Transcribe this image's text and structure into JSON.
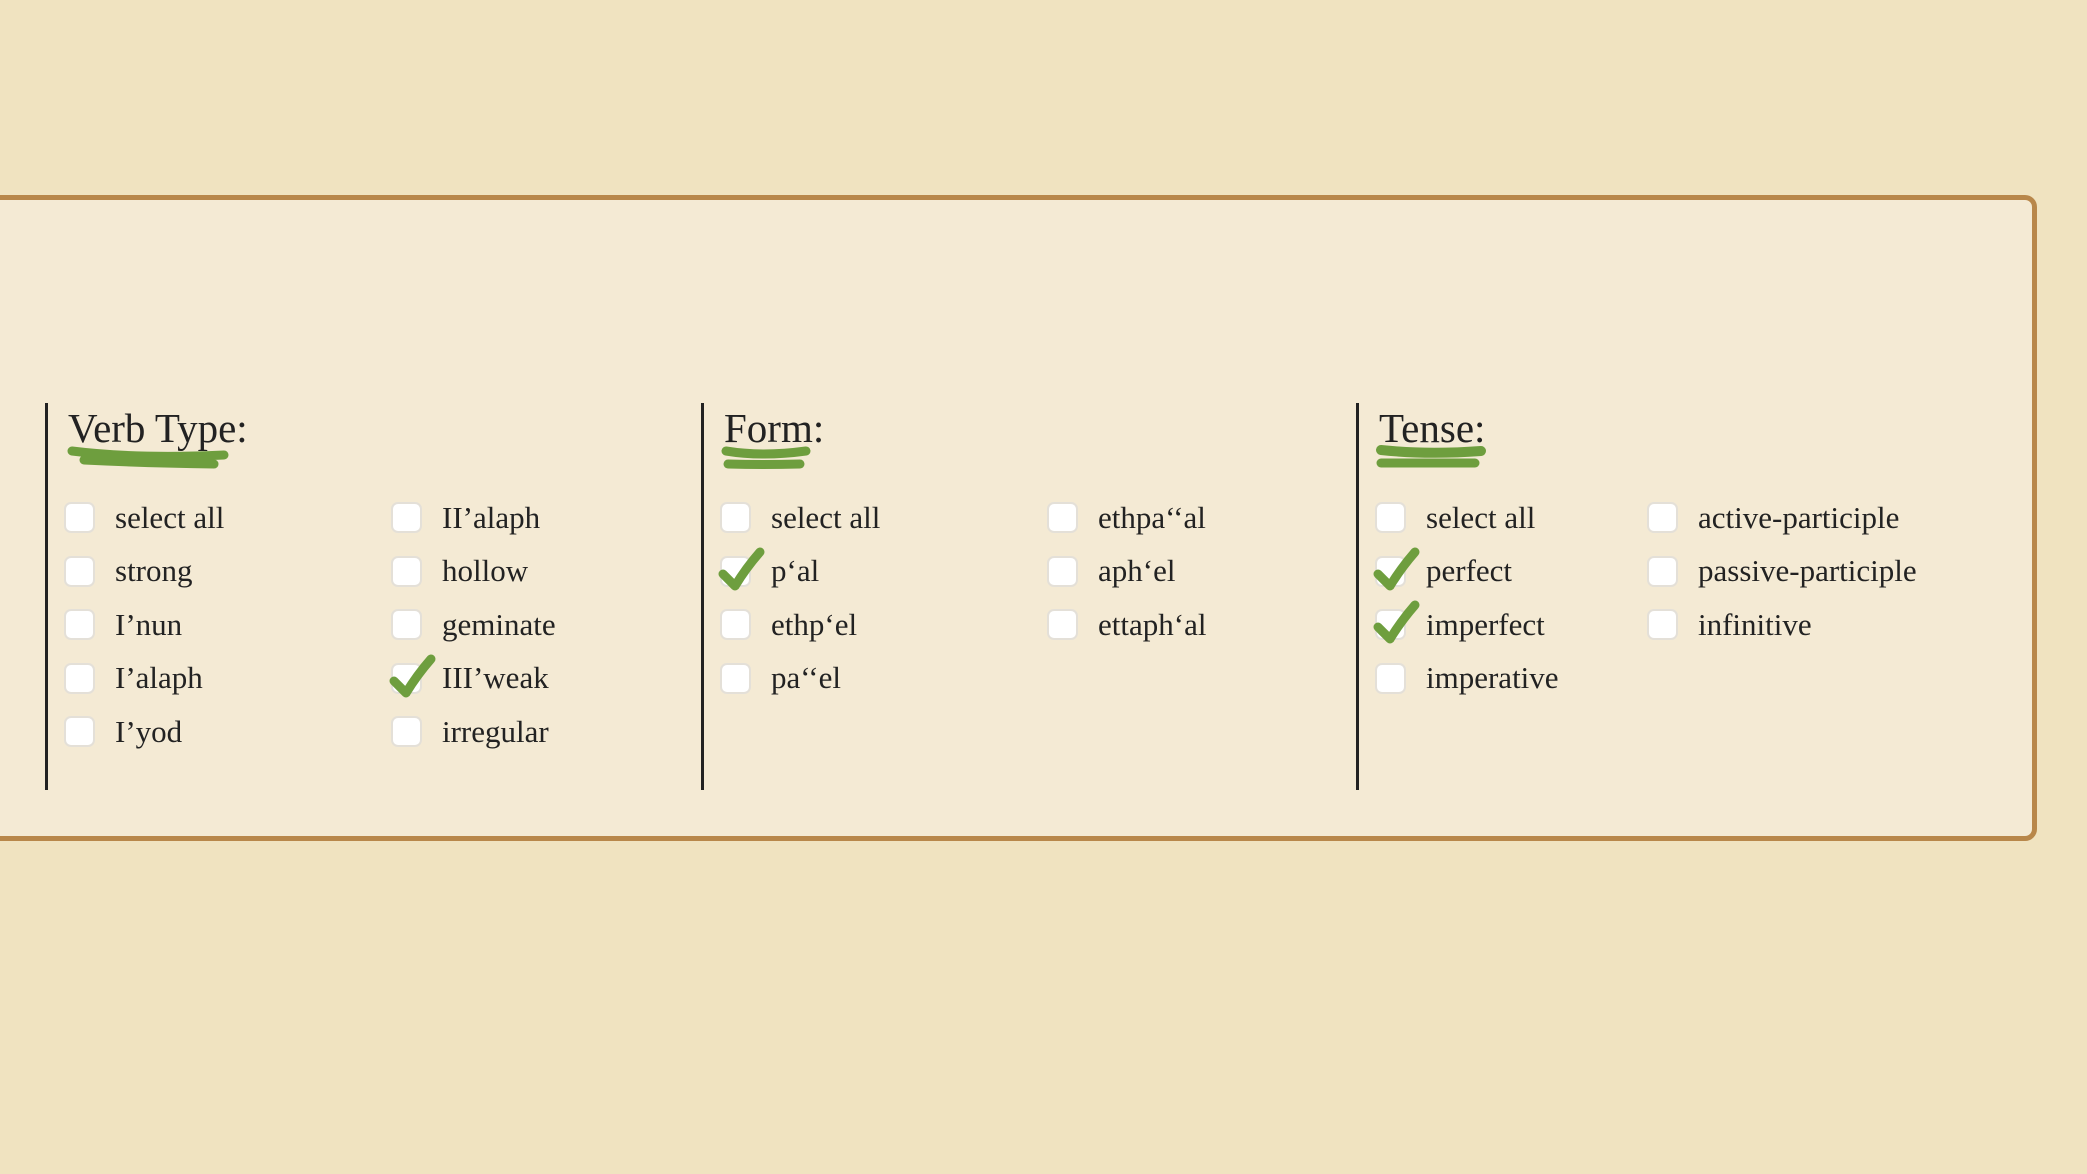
{
  "colors": {
    "page_background": "#f0e3c0",
    "panel_background": "#f4ead4",
    "panel_border": "#b8874a",
    "annotation_green": "#6e9e3e",
    "text": "#222222"
  },
  "groups": [
    {
      "title": "Verb Type:",
      "columns": [
        [
          {
            "label": "select all",
            "checked": false
          },
          {
            "label": "strong",
            "checked": false
          },
          {
            "label": "I’nun",
            "checked": false
          },
          {
            "label": "I’alaph",
            "checked": false
          },
          {
            "label": "I’yod",
            "checked": false
          }
        ],
        [
          {
            "label": "II’alaph",
            "checked": false
          },
          {
            "label": "hollow",
            "checked": false
          },
          {
            "label": "geminate",
            "checked": false
          },
          {
            "label": "III’weak",
            "checked": true
          },
          {
            "label": "irregular",
            "checked": false
          }
        ]
      ]
    },
    {
      "title": "Form:",
      "columns": [
        [
          {
            "label": "select all",
            "checked": false
          },
          {
            "label": "p‘al",
            "checked": true
          },
          {
            "label": "ethp‘el",
            "checked": false
          },
          {
            "label": "pa‘‘el",
            "checked": false
          }
        ],
        [
          {
            "label": "ethpa‘‘al",
            "checked": false
          },
          {
            "label": "aph‘el",
            "checked": false
          },
          {
            "label": "ettaph‘al",
            "checked": false
          }
        ]
      ]
    },
    {
      "title": "Tense:",
      "columns": [
        [
          {
            "label": "select all",
            "checked": false
          },
          {
            "label": "perfect",
            "checked": true
          },
          {
            "label": "imperfect",
            "checked": true
          },
          {
            "label": "imperative",
            "checked": false
          }
        ],
        [
          {
            "label": "active-participle",
            "checked": false
          },
          {
            "label": "passive-participle",
            "checked": false
          },
          {
            "label": "infinitive",
            "checked": false
          }
        ]
      ]
    }
  ]
}
